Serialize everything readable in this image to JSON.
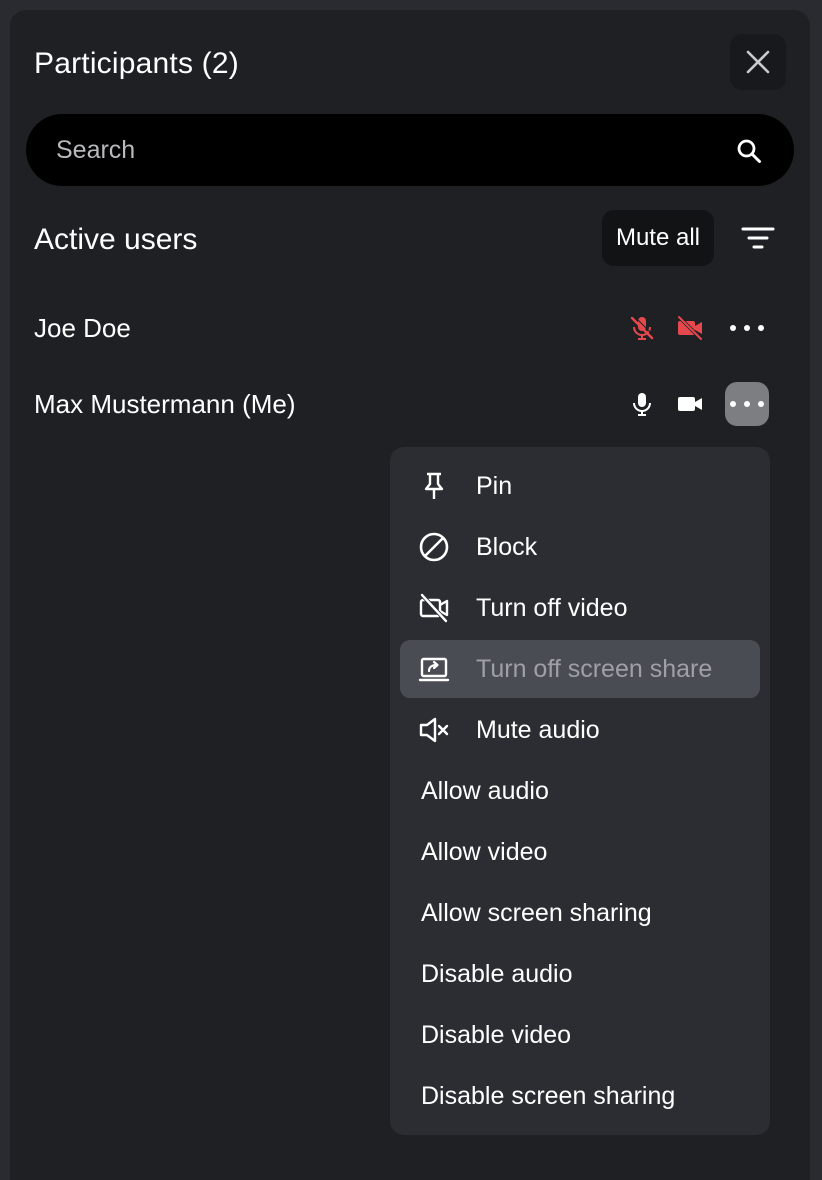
{
  "header": {
    "title": "Participants (2)",
    "close_icon": "close-icon"
  },
  "search": {
    "placeholder": "Search",
    "value": "",
    "icon": "search-icon"
  },
  "section": {
    "title": "Active users",
    "mute_all_label": "Mute all",
    "filter_icon": "filter-icon"
  },
  "users": [
    {
      "name": "Joe Doe",
      "mic_icon": "mic-off-icon",
      "video_icon": "video-off-icon",
      "more_icon": "more-horizontal-icon",
      "status_color": "#e5484d"
    },
    {
      "name": "Max Mustermann (Me)",
      "mic_icon": "mic-icon",
      "video_icon": "video-icon",
      "more_icon": "more-horizontal-icon",
      "menu_open": true
    }
  ],
  "menu": {
    "items": [
      {
        "label": "Pin",
        "icon": "pin-icon"
      },
      {
        "label": "Block",
        "icon": "block-icon"
      },
      {
        "label": "Turn off video",
        "icon": "video-off-icon"
      },
      {
        "label": "Turn off screen share",
        "icon": "screen-share-icon",
        "highlighted": true
      },
      {
        "label": "Mute audio",
        "icon": "volume-mute-icon"
      },
      {
        "label": "Allow audio"
      },
      {
        "label": "Allow video"
      },
      {
        "label": "Allow screen sharing"
      },
      {
        "label": "Disable audio"
      },
      {
        "label": "Disable video"
      },
      {
        "label": "Disable screen sharing"
      }
    ]
  },
  "colors": {
    "panel_bg": "#1f2024",
    "menu_bg": "#2c2d32",
    "highlight_bg": "#4a4c53",
    "danger": "#e5484d",
    "text": "#ffffff"
  }
}
